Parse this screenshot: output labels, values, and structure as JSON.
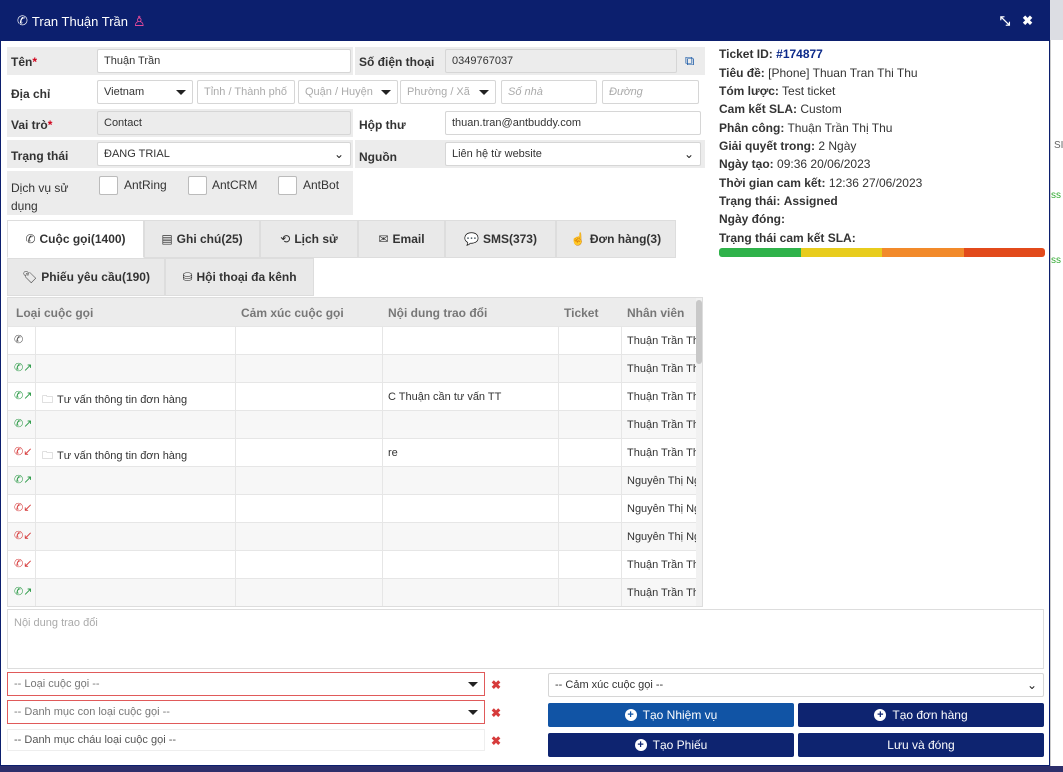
{
  "header": {
    "title": "Tran Thuận Trần"
  },
  "form": {
    "name_label": "Tên",
    "name_value": "Thuận Trần",
    "phone_label": "Số điện thoại",
    "phone_value": "0349767037",
    "address_label": "Địa chỉ",
    "country": "Vietnam",
    "province_placeholder": "Tỉnh / Thành phố",
    "district_placeholder": "Quận / Huyện",
    "ward_placeholder": "Phường / Xã",
    "house_placeholder": "Số nhà",
    "street_placeholder": "Đường",
    "role_label": "Vai trò",
    "role_value": "Contact",
    "mailbox_label": "Hộp thư",
    "mailbox_value": "thuan.tran@antbuddy.com",
    "status_label": "Trạng thái",
    "status_value": "ĐANG TRIAL",
    "source_label": "Nguồn",
    "source_value": "Liên hệ từ website",
    "services_label": "Dịch vụ sử dụng",
    "services": [
      "AntRing",
      "AntCRM",
      "AntBot"
    ]
  },
  "tabs": [
    {
      "label": "Cuộc gọi(1400)",
      "icon": "phone-icon",
      "glyph": "✆"
    },
    {
      "label": "Ghi chú(25)",
      "icon": "note-icon",
      "glyph": "▤"
    },
    {
      "label": "Lịch sử",
      "icon": "history-icon",
      "glyph": "⟲"
    },
    {
      "label": "Email",
      "icon": "envelope-icon",
      "glyph": "✉"
    },
    {
      "label": "SMS(373)",
      "icon": "chat-icon",
      "glyph": "💬"
    },
    {
      "label": "Đơn hàng(3)",
      "icon": "hand-icon",
      "glyph": "☝"
    },
    {
      "label": "Phiếu yêu cầu(190)",
      "icon": "ticket-icon",
      "glyph": "🏷"
    },
    {
      "label": "Hội thoại đa kênh",
      "icon": "cubes-icon",
      "glyph": "⛁"
    }
  ],
  "grid": {
    "headers": [
      "Loại cuộc gọi",
      "Cảm xúc cuộc gọi",
      "Nội dung trao đổi",
      "Ticket",
      "Nhân viên"
    ],
    "rows": [
      {
        "dir": "gray",
        "type": "",
        "content": "",
        "agent": "Thuận Trần Thị Thu"
      },
      {
        "dir": "green",
        "type": "",
        "content": "",
        "agent": "Thuận Trần Thị Thu"
      },
      {
        "dir": "green",
        "type": "Tư vấn thông tin đơn hàng",
        "content": "C Thuận cần tư vấn TT",
        "agent": "Thuận Trần Thị Thu"
      },
      {
        "dir": "green",
        "type": "",
        "content": "",
        "agent": "Thuận Trần Thị Thu"
      },
      {
        "dir": "red",
        "type": "Tư vấn thông tin đơn hàng",
        "content": "re",
        "agent": "Thuận Trần Thị Thu"
      },
      {
        "dir": "green",
        "type": "",
        "content": "",
        "agent": "Nguyễn Thị Nga"
      },
      {
        "dir": "red",
        "type": "",
        "content": "",
        "agent": "Nguyễn Thị Nga"
      },
      {
        "dir": "red",
        "type": "",
        "content": "",
        "agent": "Nguyễn Thị Nga"
      },
      {
        "dir": "red",
        "type": "",
        "content": "",
        "agent": "Thuận Trần Thị Thu"
      },
      {
        "dir": "green",
        "type": "",
        "content": "",
        "agent": "Thuận Trần Thị Thu"
      }
    ]
  },
  "footer": {
    "content_placeholder": "Nội dung trao đổi",
    "call_type_placeholder": "-- Loại cuộc gọi --",
    "sub_category_placeholder": "-- Danh mục con loại cuộc gọi --",
    "grandchild_category_placeholder": "-- Danh mục cháu loại cuộc gọi --",
    "emotion_placeholder": "-- Cảm xúc cuộc gọi --",
    "create_task": "Tạo Nhiệm vụ",
    "create_order": "Tạo đơn hàng",
    "create_ticket": "Tạo Phiếu",
    "save_close": "Lưu và đóng"
  },
  "ticket": {
    "id_label": "Ticket ID:",
    "id_value": "#174877",
    "title_label": "Tiêu đề:",
    "title_value": "[Phone] Thuan Tran Thi Thu",
    "summary_label": "Tóm lược:",
    "summary_value": "Test ticket",
    "sla_label": "Cam kết SLA:",
    "sla_value": "Custom",
    "assign_label": "Phân công:",
    "assign_value": "Thuận Trần Thị Thu",
    "resolve_label": "Giải quyết trong:",
    "resolve_value": "2 Ngày",
    "created_label": "Ngày tạo:",
    "created_value": "09:36 20/06/2023",
    "commit_time_label": "Thời gian cam kết:",
    "commit_time_value": "12:36 27/06/2023",
    "state_label": "Trạng thái:",
    "state_value": "Assigned",
    "closed_label": "Ngày đóng:",
    "closed_value": "",
    "sla_status_label": "Trạng thái cam kết SLA:",
    "sla_colors": [
      "#2fb24a",
      "#e8cc1c",
      "#f28a2a",
      "#e24a1b"
    ]
  },
  "colors": {
    "header_bg": "#0c1f6e",
    "primary_blue": "#1154a5",
    "navy": "#0e2470",
    "required": "#d0021b"
  }
}
